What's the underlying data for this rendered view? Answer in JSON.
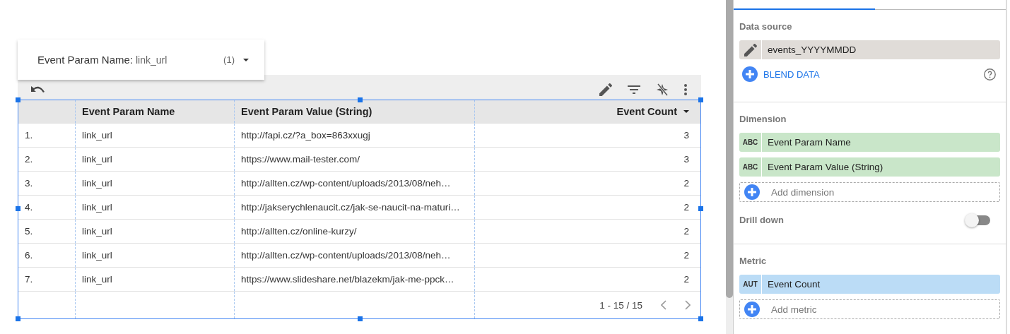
{
  "filter_chip": {
    "label": "Event Param Name:",
    "value": "link_url",
    "count": "(1)"
  },
  "table": {
    "columns": [
      {
        "label": "Event Param Name",
        "sorted": false
      },
      {
        "label": "Event Param Value (String)",
        "sorted": false
      },
      {
        "label": "Event Count",
        "sorted": true
      }
    ],
    "rows": [
      {
        "index": "1.",
        "cells": [
          "link_url",
          "http://fapi.cz/?a_box=863xxugj",
          "3"
        ]
      },
      {
        "index": "2.",
        "cells": [
          "link_url",
          "https://www.mail-tester.com/",
          "3"
        ]
      },
      {
        "index": "3.",
        "cells": [
          "link_url",
          "http://allten.cz/wp-content/uploads/2013/08/neh…",
          "2"
        ]
      },
      {
        "index": "4.",
        "cells": [
          "link_url",
          "http://jakserychlenaucit.cz/jak-se-naucit-na-maturi…",
          "2"
        ]
      },
      {
        "index": "5.",
        "cells": [
          "link_url",
          "http://allten.cz/online-kurzy/",
          "2"
        ]
      },
      {
        "index": "6.",
        "cells": [
          "link_url",
          "http://allten.cz/wp-content/uploads/2013/08/neh…",
          "2"
        ]
      },
      {
        "index": "7.",
        "cells": [
          "link_url",
          "https://www.slideshare.net/blazekm/jak-me-ppck…",
          "2"
        ]
      }
    ],
    "pagination": "1 - 15 / 15"
  },
  "panel": {
    "data_source": {
      "label": "Data source",
      "name": "events_YYYYMMDD",
      "blend_label": "BLEND DATA"
    },
    "dimension": {
      "label": "Dimension",
      "kind": "dimension",
      "fields": [
        {
          "type": "ABC",
          "name": "Event Param Name"
        },
        {
          "type": "ABC",
          "name": "Event Param Value (String)"
        }
      ],
      "add_label": "Add dimension"
    },
    "drill_down": {
      "label": "Drill down",
      "on": false
    },
    "metric": {
      "label": "Metric",
      "kind": "metric",
      "fields": [
        {
          "type": "AUT",
          "name": "Event Count"
        }
      ],
      "add_label": "Add metric"
    }
  }
}
